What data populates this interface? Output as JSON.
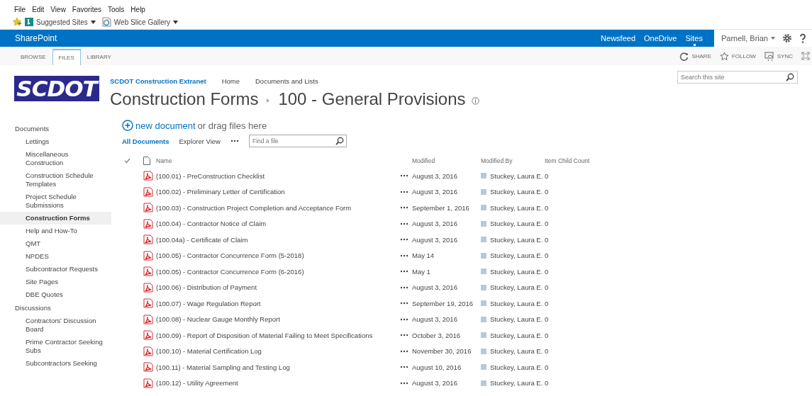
{
  "menu_bar": [
    "File",
    "Edit",
    "View",
    "Favorites",
    "Tools",
    "Help"
  ],
  "favorites_bar": [
    {
      "label": "Suggested Sites",
      "kind": "bing"
    },
    {
      "label": "Web Slice Gallery",
      "kind": "ie"
    }
  ],
  "suite_bar": {
    "brand": "SharePoint",
    "links": [
      {
        "label": "Newsfeed",
        "selected": false
      },
      {
        "label": "OneDrive",
        "selected": false
      },
      {
        "label": "Sites",
        "selected": true
      }
    ],
    "user": "Parnell, Brian"
  },
  "ribbon": {
    "tabs": [
      {
        "label": "BROWSE",
        "selected": false
      },
      {
        "label": "FILES",
        "selected": true
      },
      {
        "label": "LIBRARY",
        "selected": false
      }
    ],
    "actions": [
      {
        "label": "SHARE",
        "kind": "share"
      },
      {
        "label": "FOLLOW",
        "kind": "follow"
      },
      {
        "label": "SYNC",
        "kind": "sync"
      }
    ]
  },
  "header": {
    "logo": "SCDOT",
    "site_title": "SCDOT Construction Extranet",
    "nav": [
      "Home",
      "Documents and Lists"
    ],
    "breadcrumb": [
      "Construction Forms",
      "100 - General Provisions"
    ],
    "search_placeholder": "Search this site"
  },
  "sidebar": [
    {
      "label": "Documents",
      "children": [
        {
          "label": "Lettings",
          "selected": false
        },
        {
          "label": "Miscellaneous Construction",
          "selected": false
        },
        {
          "label": "Construction Schedule Templates",
          "selected": false
        },
        {
          "label": "Project Schedule Submissions",
          "selected": false
        },
        {
          "label": "Construction Forms",
          "selected": true
        },
        {
          "label": "Help and How-To",
          "selected": false
        },
        {
          "label": "QMT",
          "selected": false
        },
        {
          "label": "NPDES",
          "selected": false
        },
        {
          "label": "Subcontractor Requests",
          "selected": false
        },
        {
          "label": "Site Pages",
          "selected": false
        },
        {
          "label": "DBE Quotes",
          "selected": false
        }
      ]
    },
    {
      "label": "Discussions",
      "children": [
        {
          "label": "Contractors' Discussion Board",
          "selected": false
        },
        {
          "label": "Prime Contractor Seeking Subs",
          "selected": false
        },
        {
          "label": "Subcontractors Seeking",
          "selected": false
        }
      ]
    }
  ],
  "toolbar": {
    "new_document": "new document",
    "drop_hint": "or drag files here",
    "views": [
      {
        "label": "All Documents",
        "selected": true
      },
      {
        "label": "Explorer View",
        "selected": false
      }
    ],
    "find_placeholder": "Find a file"
  },
  "table": {
    "columns": [
      "Name",
      "Modified",
      "Modified By",
      "Item Child Count"
    ],
    "rows": [
      {
        "name": "(100.01) - PreConstruction Checklist",
        "modified": "August 3, 2016",
        "modified_by": "Stuckey, Laura E.",
        "child_count": "0"
      },
      {
        "name": "(100.02) - Preliminary Letter of Certification",
        "modified": "August 3, 2016",
        "modified_by": "Stuckey, Laura E.",
        "child_count": "0"
      },
      {
        "name": "(100.03) - Construction Project Completion and Acceptance Form",
        "modified": "September 1, 2016",
        "modified_by": "Stuckey, Laura E.",
        "child_count": "0"
      },
      {
        "name": "(100.04) - Contractor Notice of Claim",
        "modified": "August 3, 2016",
        "modified_by": "Stuckey, Laura E.",
        "child_count": "0"
      },
      {
        "name": "(100.04a) - Certificate of Claim",
        "modified": "August 3, 2016",
        "modified_by": "Stuckey, Laura E.",
        "child_count": "0"
      },
      {
        "name": "(100.05) - Contractor Concurrence Form (5-2018)",
        "modified": "May 14",
        "modified_by": "Stuckey, Laura E.",
        "child_count": "0"
      },
      {
        "name": "(100.05) - Contractor Concurrence Form (6-2016)",
        "modified": "May 1",
        "modified_by": "Stuckey, Laura E.",
        "child_count": "0"
      },
      {
        "name": "(100.06) - Distribution of Payment",
        "modified": "August 3, 2016",
        "modified_by": "Stuckey, Laura E.",
        "child_count": "0"
      },
      {
        "name": "(100.07) - Wage Regulation Report",
        "modified": "September 19, 2016",
        "modified_by": "Stuckey, Laura E.",
        "child_count": "0"
      },
      {
        "name": "(100.08) - Nuclear Gauge Monthly Report",
        "modified": "August 3, 2016",
        "modified_by": "Stuckey, Laura E.",
        "child_count": "0"
      },
      {
        "name": "(100.09) - Report of Disposition of Material Failing to Meet Specifications",
        "modified": "October 3, 2016",
        "modified_by": "Stuckey, Laura E.",
        "child_count": "0"
      },
      {
        "name": "(100.10) - Material Certification Log",
        "modified": "November 30, 2016",
        "modified_by": "Stuckey, Laura E.",
        "child_count": "0"
      },
      {
        "name": "(100.11) - Material Sampling and Testing Log",
        "modified": "August 10, 2016",
        "modified_by": "Stuckey, Laura E.",
        "child_count": "0"
      },
      {
        "name": "(100.12) - Utility Agreement",
        "modified": "August 3, 2016",
        "modified_by": "Stuckey, Laura E.",
        "child_count": "0"
      }
    ]
  }
}
